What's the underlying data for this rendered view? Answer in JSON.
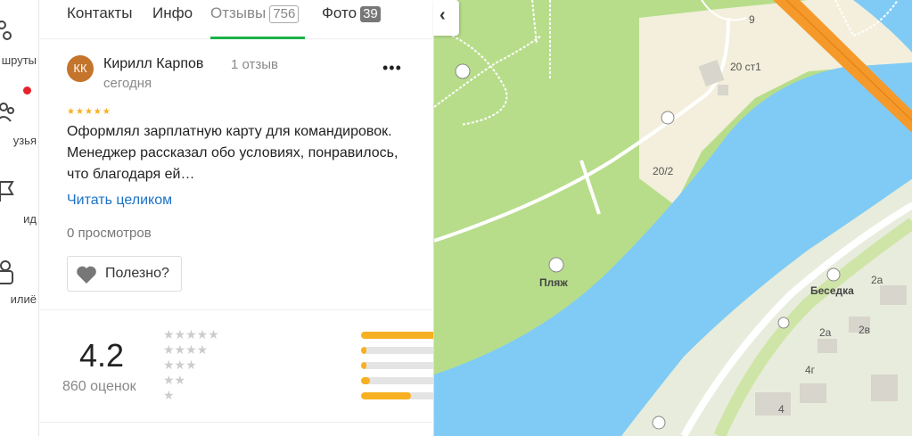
{
  "nav": {
    "routes_label": "шруты",
    "friends_label": "узья",
    "guide_label": "ид",
    "family_label": "илиё"
  },
  "tabs": [
    {
      "label": "Контакты"
    },
    {
      "label": "Инфо"
    },
    {
      "label": "Отзывы",
      "badge": "756"
    },
    {
      "label": "Фото",
      "badge": "39"
    }
  ],
  "review": {
    "avatar_initials": "КК",
    "author": "Кирилл Карпов",
    "author_reviews": "1 отзыв",
    "date": "сегодня",
    "more": "•••",
    "stars": 5,
    "text": "Оформлял зарплатную карту для командировок. Менеджер рассказал обо условиях, понравилось, что благодаря ей…",
    "read_more": "Читать целиком",
    "views": "0 просмотров",
    "useful_label": "Полезно?"
  },
  "rating": {
    "value": "4.2",
    "count_label": "860 оценок",
    "distribution": [
      {
        "stars": 5,
        "fraction": 1.0
      },
      {
        "stars": 4,
        "fraction": 0.03
      },
      {
        "stars": 3,
        "fraction": 0.03
      },
      {
        "stars": 2,
        "fraction": 0.05
      },
      {
        "stars": 1,
        "fraction": 0.29
      }
    ]
  },
  "map": {
    "toggle_icon": "chevron-left-icon",
    "labels": {
      "beach": "Пляж",
      "gazebo": "Беседка",
      "b_9": "9",
      "b_20st1": "20 ст1",
      "b_20_2": "20/2",
      "b_2a_1": "2а",
      "b_2a_2": "2а",
      "b_2v": "2в",
      "b_4g": "4г",
      "b_4": "4"
    }
  },
  "colors": {
    "accent_green": "#1ab248",
    "star": "#f6b021",
    "link": "#1b72c7",
    "water": "#7fcbf6",
    "park": "#b7dd8a",
    "sand": "#f3efdc",
    "road_orange": "#f59a2a"
  }
}
